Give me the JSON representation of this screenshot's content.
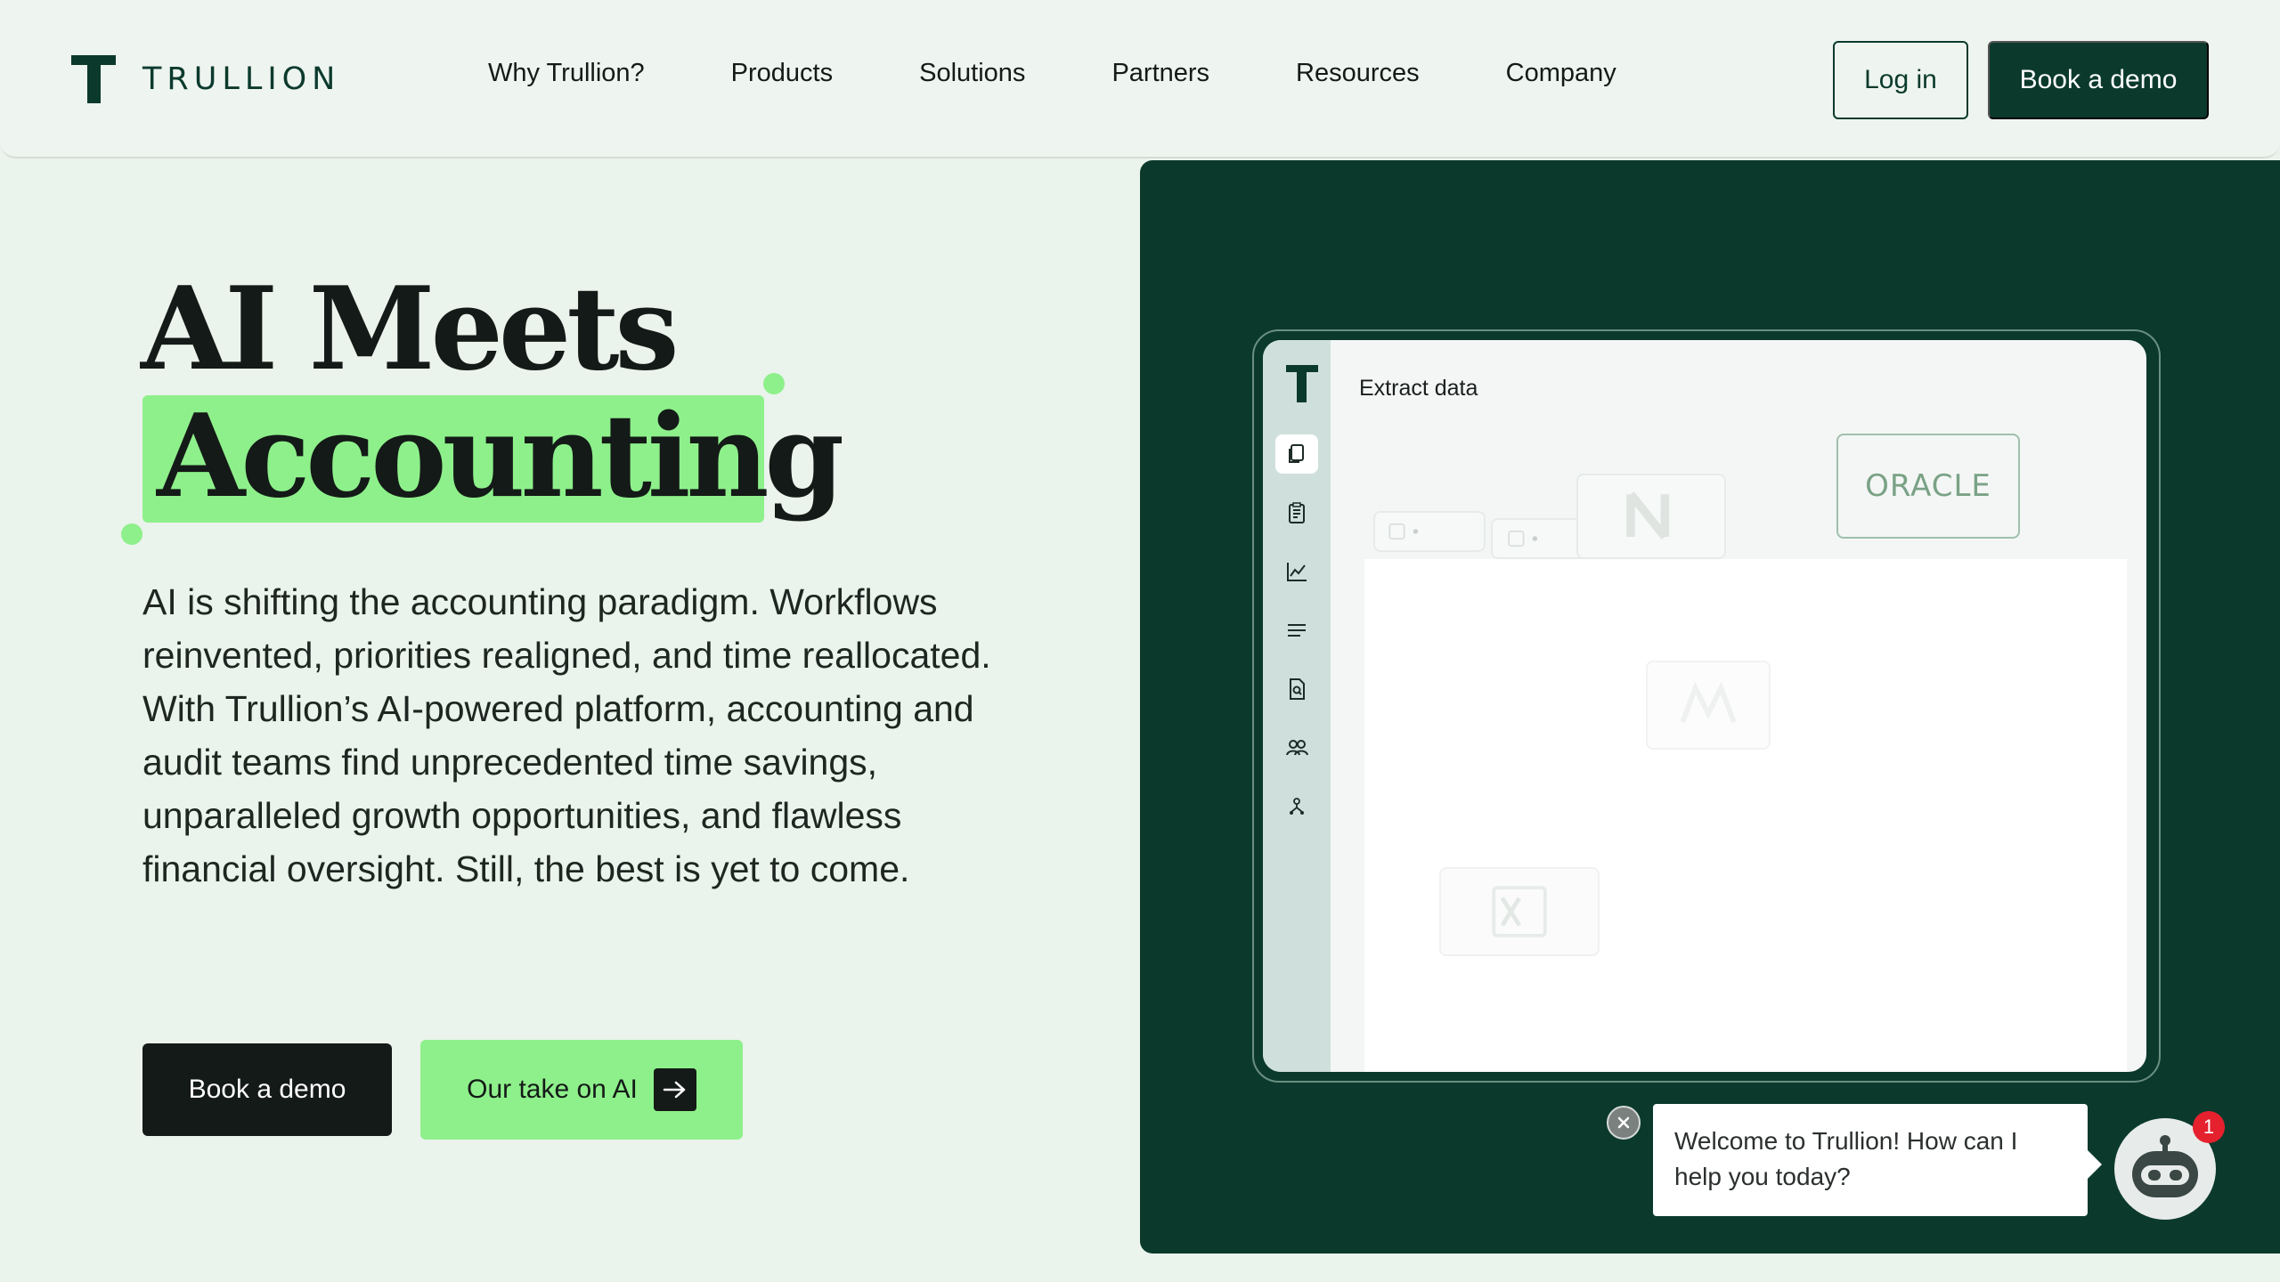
{
  "brand": {
    "name": "TRULLION"
  },
  "nav": {
    "items": [
      "Why Trullion?",
      "Products",
      "Solutions",
      "Partners",
      "Resources",
      "Company"
    ]
  },
  "header": {
    "login_label": "Log in",
    "demo_label": "Book a demo"
  },
  "hero": {
    "title_line1": "AI Meets",
    "title_line2": "Accounting",
    "body": "AI is shifting the accounting paradigm. Workflows reinvented, priorities realigned, and time reallocated. With Trullion’s AI-powered platform, accounting and audit teams find unprecedented time savings, unparalleled growth opportunities, and flawless financial oversight. Still, the best is yet to come.",
    "cta_primary": "Book a demo",
    "cta_secondary": "Our take on AI"
  },
  "app_preview": {
    "section_title": "Extract data",
    "integration_logo": "ORACLE",
    "sidebar_icons": [
      "documents-icon",
      "clipboard-icon",
      "chart-icon",
      "list-icon",
      "file-search-icon",
      "users-icon",
      "hierarchy-icon"
    ]
  },
  "chat": {
    "message": "Welcome to Trullion! How can I help you today?",
    "badge_count": "1"
  },
  "colors": {
    "brand_dark": "#0b3a2d",
    "accent_green": "#8ef08b",
    "background": "#eaf3ec"
  }
}
